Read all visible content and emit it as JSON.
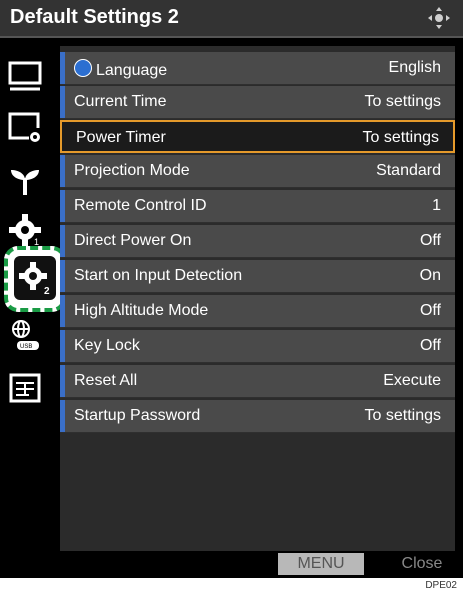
{
  "header": {
    "title": "Default Settings 2",
    "nav_icon": "four-way-arrow-icon"
  },
  "sidebar": {
    "icons": [
      "display-icon",
      "display-settings-icon",
      "eco-plant-icon",
      "settings-gear-icon",
      "settings-gear-2-icon",
      "network-usb-icon",
      "info-panel-icon"
    ],
    "selected_index": 4
  },
  "menu": {
    "rows": [
      {
        "label": "Language",
        "value": "English",
        "icon": "globe-icon"
      },
      {
        "label": "Current Time",
        "value": "To settings"
      },
      {
        "label": "Power Timer",
        "value": "To settings",
        "selected": true
      },
      {
        "label": "Projection Mode",
        "value": "Standard"
      },
      {
        "label": "Remote Control ID",
        "value": "1"
      },
      {
        "label": "Direct Power On",
        "value": "Off"
      },
      {
        "label": "Start on Input Detection",
        "value": "On"
      },
      {
        "label": "High Altitude Mode",
        "value": "Off"
      },
      {
        "label": "Key Lock",
        "value": "Off"
      },
      {
        "label": "Reset All",
        "value": "Execute"
      },
      {
        "label": "Startup Password",
        "value": "To settings"
      }
    ]
  },
  "footer": {
    "menu_label": "MENU",
    "close_label": "Close"
  },
  "figure_code": "DPE02",
  "colors": {
    "row_accent": "#3a6fc8",
    "selected_border": "#e59a2b",
    "highlight_dash": "#1a9b45"
  }
}
